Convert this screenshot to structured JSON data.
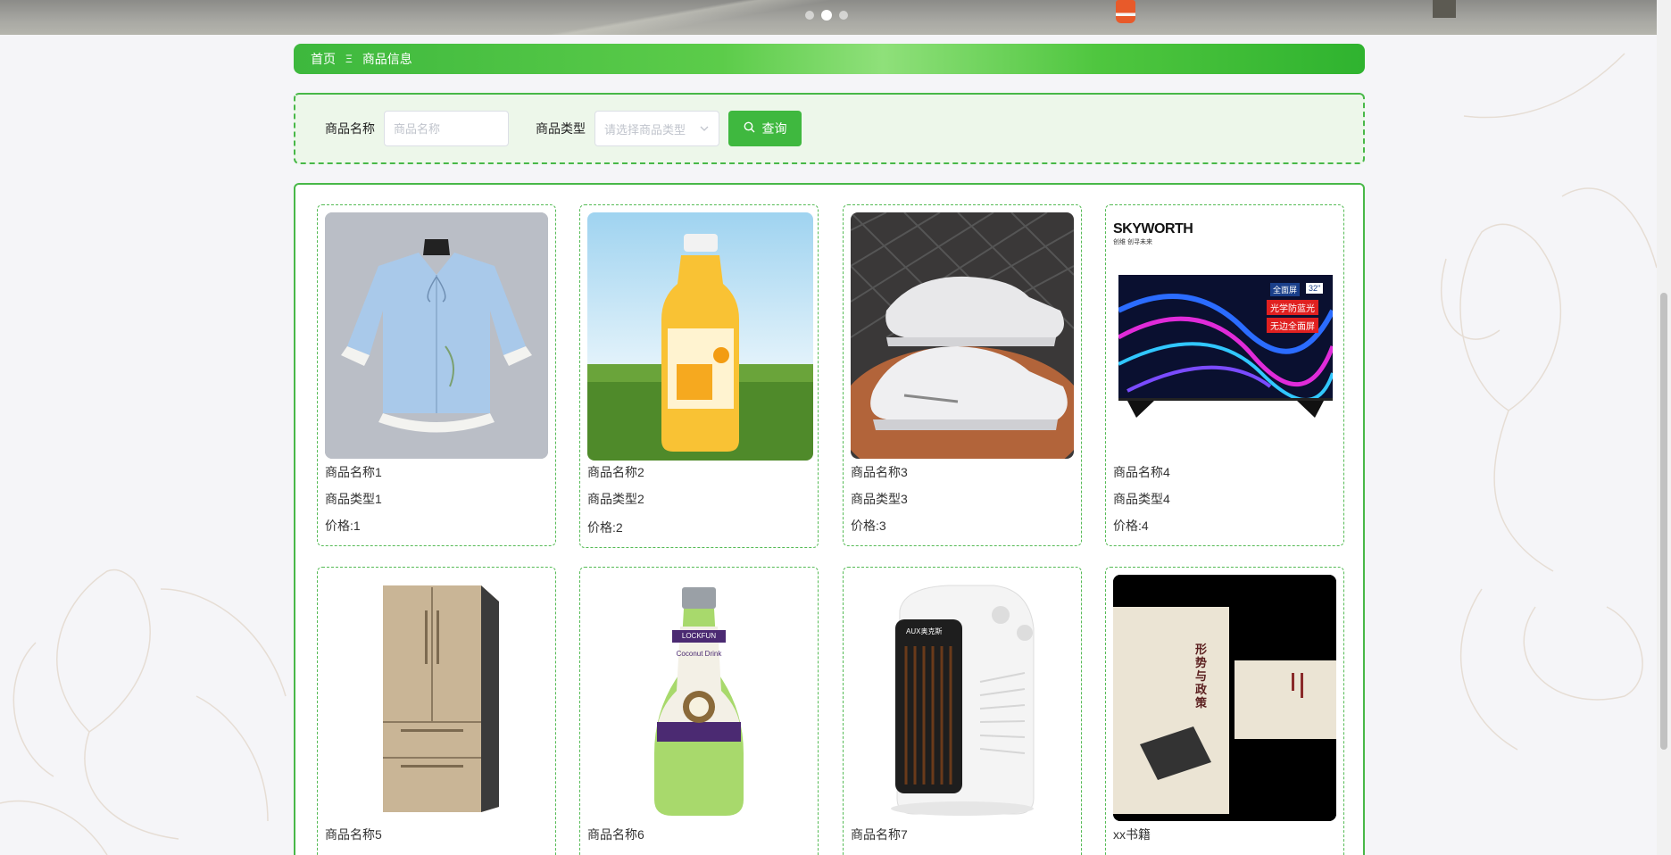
{
  "carousel": {
    "dots": 3,
    "active_index": 1
  },
  "breadcrumb": {
    "home": "首页",
    "separator": "Ξ",
    "current": "商品信息"
  },
  "search": {
    "name_label": "商品名称",
    "name_placeholder": "商品名称",
    "type_label": "商品类型",
    "type_placeholder": "请选择商品类型",
    "button_label": "查询"
  },
  "products": [
    {
      "name": "商品名称1",
      "type": "商品类型1",
      "price": "价格:1",
      "image": "blue-blouse"
    },
    {
      "name": "商品名称2",
      "type": "商品类型2",
      "price": "价格:2",
      "image": "mango-juice-bottle"
    },
    {
      "name": "商品名称3",
      "type": "商品类型3",
      "price": "价格:3",
      "image": "white-sneakers"
    },
    {
      "name": "商品名称4",
      "type": "商品类型4",
      "price": "价格:4",
      "image": "skyworth-tv",
      "tv_brand": "SKYWORTH",
      "tv_slogan": "创维 创寻未来",
      "tv_badges": [
        "全面屏",
        "32\"",
        "光学防蓝光",
        "无边全面屏"
      ]
    },
    {
      "name": "商品名称5",
      "image": "refrigerator"
    },
    {
      "name": "商品名称6",
      "image": "coconut-drink-bottle",
      "bottle_brand": "LOCKFUN",
      "bottle_text": "Coconut Drink"
    },
    {
      "name": "商品名称7",
      "image": "space-heater",
      "heater_brand": "AUX奥克斯"
    },
    {
      "name": "xx书籍",
      "image": "book",
      "book_title": "形势与政策"
    }
  ],
  "colors": {
    "accent": "#3fb83f",
    "panel": "#edf7ea",
    "border": "#48b848"
  }
}
